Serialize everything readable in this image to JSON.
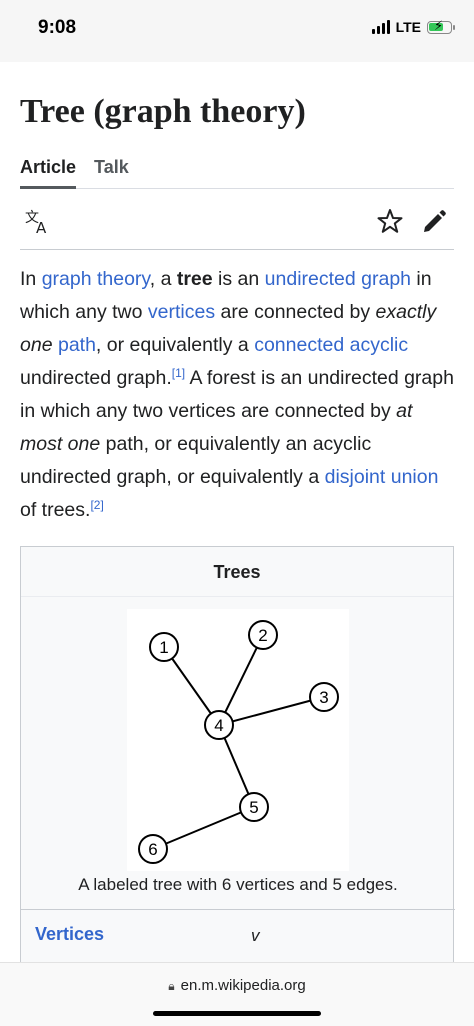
{
  "status": {
    "time": "9:08",
    "network": "LTE"
  },
  "page": {
    "title": "Tree (graph theory)"
  },
  "tabs": [
    {
      "label": "Article"
    },
    {
      "label": "Talk"
    }
  ],
  "lead": {
    "s1": "In ",
    "l1": "graph theory",
    "s2": ", a ",
    "b1": "tree",
    "s3": " is an ",
    "l2": "undirected graph",
    "s4": " in which any two ",
    "l3": "vertices",
    "s5": " are connected by ",
    "i1": "exactly one",
    "s6": " ",
    "l4": "path",
    "s7": ", or equivalently a ",
    "l5": "connected acyclic",
    "s8": " undirected graph.",
    "ref1": "[1]",
    "s9": " A forest is an undirected graph in which any two vertices are connected by ",
    "i2": "at most one",
    "s10": " path, or equivalently an acyclic undirected graph, or equivalently a ",
    "l6": "disjoint union",
    "s11": " of trees.",
    "ref2": "[2]"
  },
  "infobox": {
    "title": "Trees",
    "caption": "A labeled tree with 6 vertices and 5 edges.",
    "diagram": {
      "nodes": [
        {
          "id": "1",
          "label": "1"
        },
        {
          "id": "2",
          "label": "2"
        },
        {
          "id": "3",
          "label": "3"
        },
        {
          "id": "4",
          "label": "4"
        },
        {
          "id": "5",
          "label": "5"
        },
        {
          "id": "6",
          "label": "6"
        }
      ],
      "edges": [
        [
          "1",
          "4"
        ],
        [
          "2",
          "4"
        ],
        [
          "3",
          "4"
        ],
        [
          "4",
          "5"
        ],
        [
          "5",
          "6"
        ]
      ]
    },
    "rows": [
      {
        "label": "Vertices",
        "value": "v"
      }
    ]
  },
  "bottom": {
    "url": "en.m.wikipedia.org"
  },
  "colors": {
    "link": "#3366cc",
    "text": "#202122",
    "battery": "#34c759"
  },
  "icons": [
    "translate-icon",
    "star-icon",
    "edit-pencil-icon",
    "lock-icon"
  ]
}
